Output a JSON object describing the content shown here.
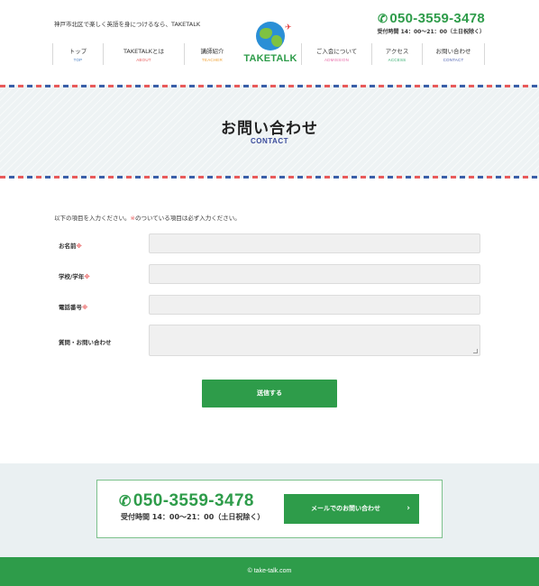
{
  "header": {
    "tagline": "神戸市北区で楽しく英語を身につけるなら、TAKETALK",
    "phone": "050-3559-3478",
    "hours": "受付時間 14：00～21：00（土日祝除く）",
    "logo_text": "TAKETALK",
    "phone_icon": "phone-icon"
  },
  "nav": {
    "left": [
      {
        "jp": "トップ",
        "en": "TOP",
        "color": "#4a7fc4"
      },
      {
        "jp": "TAKETALKとは",
        "en": "ABOUT",
        "color": "#e85a5a"
      },
      {
        "jp": "講師紹介",
        "en": "TEACHER",
        "color": "#f0a030"
      }
    ],
    "right": [
      {
        "jp": "ご入会について",
        "en": "ADMISSION",
        "color": "#e86aa8"
      },
      {
        "jp": "アクセス",
        "en": "ACCESS",
        "color": "#2eaa6a"
      },
      {
        "jp": "お問い合わせ",
        "en": "CONTACT",
        "color": "#4a5fb0"
      }
    ]
  },
  "hero": {
    "title": "お問い合わせ",
    "subtitle": "CONTACT"
  },
  "form": {
    "intro_before": "以下の項目を入力ください。",
    "intro_mark": "※",
    "intro_after": "のついている項目は必ず入力ください。",
    "required_mark": "※",
    "fields": [
      {
        "label": "お名前",
        "required": true,
        "value": ""
      },
      {
        "label": "学校/学年",
        "required": true,
        "value": ""
      },
      {
        "label": "電話番号",
        "required": true,
        "value": ""
      },
      {
        "label": "質問・お問い合わせ",
        "required": false,
        "value": ""
      }
    ],
    "submit_label": "送信する"
  },
  "cta": {
    "phone": "050-3559-3478",
    "hours": "受付時間 14：00～21：00（土日祝除く）",
    "mail_label": "メールでのお問い合わせ",
    "chevron": "›"
  },
  "footer": {
    "copyright": "© take-talk.com"
  },
  "colors": {
    "brand_green": "#2e9c4a",
    "required_red": "#e85a5a",
    "contact_blue": "#3a4b9c"
  }
}
